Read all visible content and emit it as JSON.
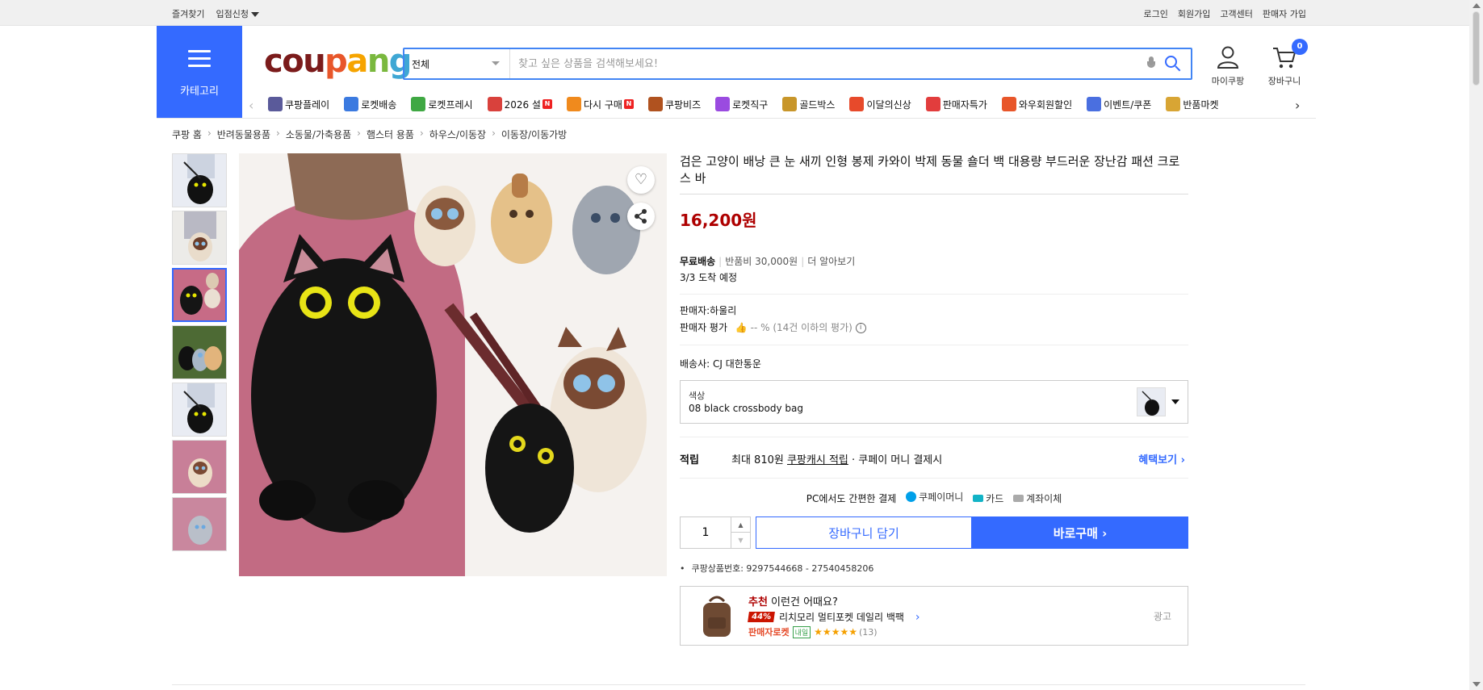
{
  "topbar": {
    "left": [
      "즐겨찾기",
      "입점신청"
    ],
    "right": [
      "로그인",
      "회원가입",
      "고객센터",
      "판매자 가입"
    ]
  },
  "header": {
    "category_label": "카테고리",
    "logo": [
      "cou",
      "p",
      "a",
      "n",
      "g"
    ],
    "search": {
      "category": "전체",
      "placeholder": "찾고 싶은 상품을 검색해보세요!"
    },
    "mycoupang_label": "마이쿠팡",
    "cart_label": "장바구니",
    "cart_count": "0"
  },
  "nav": {
    "items": [
      {
        "label": "쿠팡플레이",
        "icon": "play-icon",
        "color": "#5a5a9a"
      },
      {
        "label": "로켓배송",
        "icon": "rocket-icon",
        "color": "#3b7ae0"
      },
      {
        "label": "로켓프레시",
        "icon": "fresh-rocket-icon",
        "color": "#3fa843"
      },
      {
        "label": "2026 설",
        "icon": "gift-icon",
        "color": "#d9413c",
        "badge": "N"
      },
      {
        "label": "다시 구매",
        "icon": "rebuy-icon",
        "color": "#f08a1d",
        "badge": "N"
      },
      {
        "label": "쿠팡비즈",
        "icon": "biz-icon",
        "color": "#b0521f"
      },
      {
        "label": "로켓직구",
        "icon": "global-icon",
        "color": "#9a4be0"
      },
      {
        "label": "골드박스",
        "icon": "goldbox-icon",
        "color": "#c8962a"
      },
      {
        "label": "이달의신상",
        "icon": "new-bag-icon",
        "color": "#e74a2b"
      },
      {
        "label": "판매자특가",
        "icon": "percent-icon",
        "color": "#e23d3d"
      },
      {
        "label": "와우회원할인",
        "icon": "wow-icon",
        "color": "#e8562a"
      },
      {
        "label": "이벤트/쿠폰",
        "icon": "coupon-icon",
        "color": "#4a6fe0"
      },
      {
        "label": "반품마켓",
        "icon": "returns-icon",
        "color": "#d8a534"
      }
    ],
    "nbadge": "N"
  },
  "breadcrumb": [
    "쿠팡 홈",
    "반려동물용품",
    "소동물/가축용품",
    "햄스터 용품",
    "하우스/이동장",
    "이동장/이동가방"
  ],
  "product": {
    "title": "검은 고양이 배낭 큰 눈 새끼 인형 봉제 카와이 박제 동물 숄더 백 대용량 부드러운 장난감 패션 크로스 바",
    "price": "16,200원",
    "shipping": {
      "free": "무료배송",
      "return_fee": "반품비 30,000원",
      "more": "더 알아보기",
      "arrival": "3/3 도착 예정"
    },
    "seller": {
      "name": "판매자:하울리",
      "rating_label": "판매자 평가",
      "rating_value": "-- % (14건 이하의 평가)"
    },
    "courier": "배송사:  CJ 대한통운",
    "option": {
      "label": "색상",
      "value": "08 black crossbody bag"
    },
    "points": {
      "label": "적립",
      "max": "최대 810원",
      "cash": "쿠팡캐시 적립",
      "note": "· 쿠페이 머니 결제시",
      "benefit": "혜택보기 ›"
    },
    "easypay": {
      "title": "PC에서도 간편한 결제",
      "methods": [
        "쿠페이머니",
        "카드",
        "계좌이체"
      ]
    },
    "quantity": "1",
    "add_to_cart": "장바구니 담기",
    "buy_now": "바로구매 ›",
    "product_no": "쿠팡상품번호: 9297544668 - 27540458206"
  },
  "recommend": {
    "prefix": "추천",
    "title": " 이런건 어때요?",
    "discount": "44%",
    "name": "리치모리 멀티포켓 데일리 백팩",
    "seller_rocket": "판매자로켓",
    "tomorrow": "내일",
    "stars": "★★★★★",
    "count": "(13)",
    "ad": "광고"
  }
}
